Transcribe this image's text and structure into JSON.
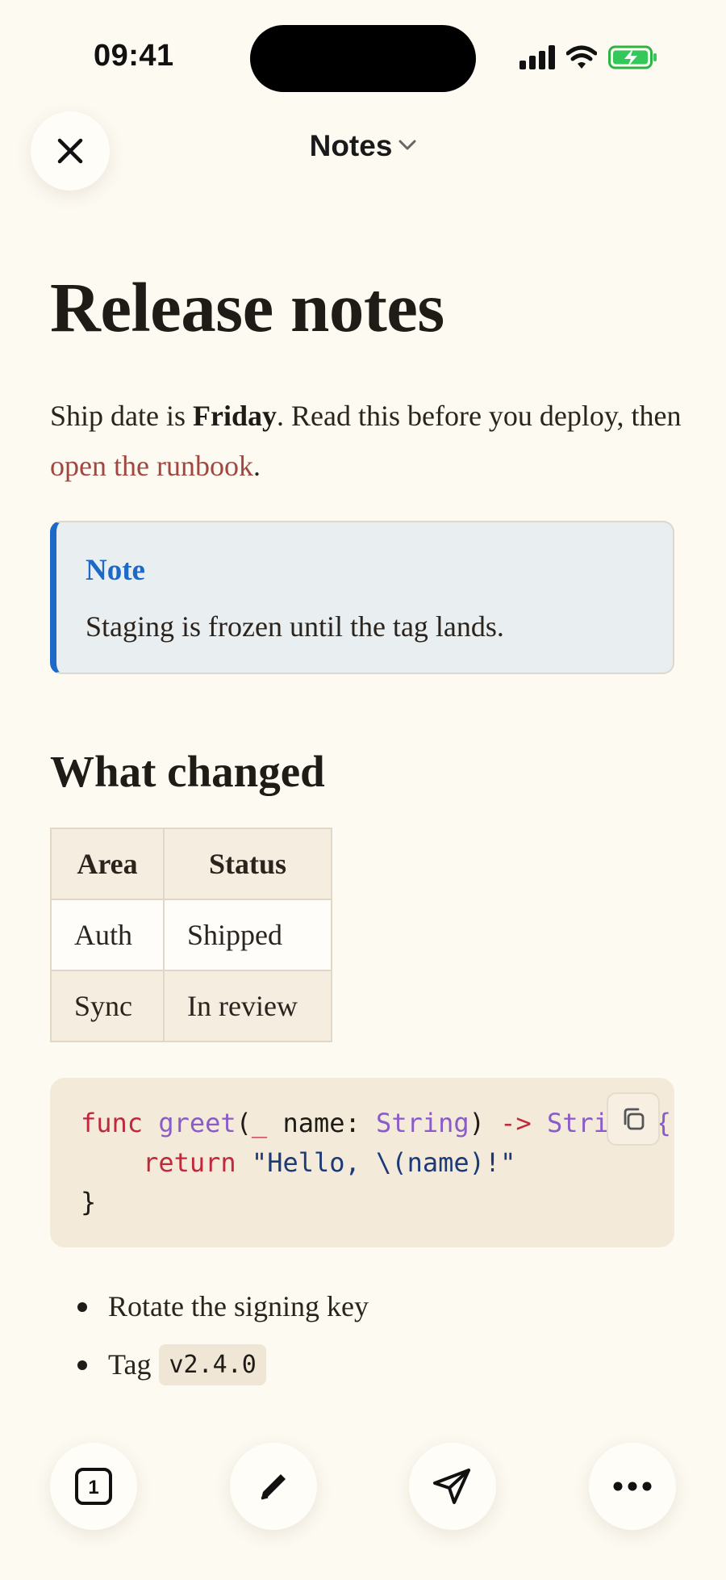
{
  "status_bar": {
    "time": "09:41"
  },
  "nav": {
    "title": "Notes"
  },
  "document": {
    "title": "Release notes",
    "intro": {
      "part1": "Ship date is ",
      "bold": "Friday",
      "part2": ". Read this before you deploy, then ",
      "link": "open the runbook",
      "part3": "."
    },
    "callout": {
      "title": "Note",
      "body": "Staging is frozen until the tag lands."
    },
    "section_heading": "What changed",
    "table": {
      "headers": [
        "Area",
        "Status"
      ],
      "rows": [
        [
          "Auth",
          "Shipped"
        ],
        [
          "Sync",
          "In review"
        ]
      ]
    },
    "code": {
      "line1": {
        "kw": "func",
        "name": "greet",
        "p1": "(",
        "underscore": "_",
        "p2": " name: ",
        "type": "String",
        "p3": ") ",
        "arrow": "->",
        "ret": " String {"
      },
      "line2": {
        "indent": "    ",
        "kw": "return",
        "str": " \"Hello, \\(name)!\""
      },
      "line3": "}"
    },
    "bullets": {
      "item1": "Rotate the signing key",
      "item2_text": "Tag",
      "item2_code": "v2.4.0"
    }
  },
  "toolbar": {
    "pages_count": "1"
  },
  "colors": {
    "accent": "#1d69c8",
    "link": "#a1473f",
    "keyword": "#c0293b",
    "background": "#fdfaf2"
  },
  "icons": [
    "close-icon",
    "chevron-down-icon",
    "cellular-icon",
    "wifi-icon",
    "battery-charging-icon",
    "copy-icon",
    "pages-icon",
    "pencil-icon",
    "send-icon",
    "more-icon"
  ]
}
